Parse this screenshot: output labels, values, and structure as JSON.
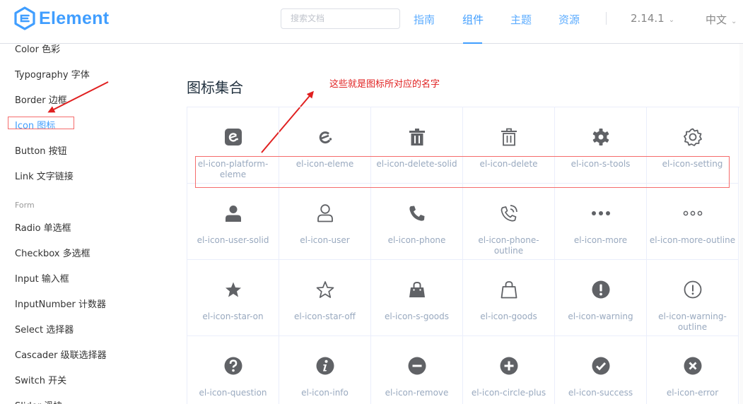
{
  "header": {
    "logo_text": "Element",
    "search_placeholder": "搜索文档",
    "nav": [
      {
        "label": "指南"
      },
      {
        "label": "组件"
      },
      {
        "label": "主题"
      },
      {
        "label": "资源"
      }
    ],
    "version": "2.14.1",
    "language": "中文"
  },
  "sidebar": {
    "items_top": [
      {
        "label": "Color 色彩"
      },
      {
        "label": "Typography 字体"
      },
      {
        "label": "Border 边框"
      },
      {
        "label": "Icon 图标"
      },
      {
        "label": "Button 按钮"
      },
      {
        "label": "Link 文字链接"
      }
    ],
    "group_form": "Form",
    "items_form": [
      {
        "label": "Radio 单选框"
      },
      {
        "label": "Checkbox 多选框"
      },
      {
        "label": "Input 输入框"
      },
      {
        "label": "InputNumber 计数器"
      },
      {
        "label": "Select 选择器"
      },
      {
        "label": "Cascader 级联选择器"
      },
      {
        "label": "Switch 开关"
      },
      {
        "label": "Slider 滑块"
      }
    ]
  },
  "main": {
    "title": "图标集合",
    "annotation": "这些就是图标所对应的名字",
    "icons": [
      {
        "icon": "platform-eleme",
        "name": "el-icon-platform-eleme"
      },
      {
        "icon": "eleme",
        "name": "el-icon-eleme"
      },
      {
        "icon": "delete-solid",
        "name": "el-icon-delete-solid"
      },
      {
        "icon": "delete",
        "name": "el-icon-delete"
      },
      {
        "icon": "s-tools",
        "name": "el-icon-s-tools"
      },
      {
        "icon": "setting",
        "name": "el-icon-setting"
      },
      {
        "icon": "user-solid",
        "name": "el-icon-user-solid"
      },
      {
        "icon": "user",
        "name": "el-icon-user"
      },
      {
        "icon": "phone",
        "name": "el-icon-phone"
      },
      {
        "icon": "phone-outline",
        "name": "el-icon-phone-outline"
      },
      {
        "icon": "more",
        "name": "el-icon-more"
      },
      {
        "icon": "more-outline",
        "name": "el-icon-more-outline"
      },
      {
        "icon": "star-on",
        "name": "el-icon-star-on"
      },
      {
        "icon": "star-off",
        "name": "el-icon-star-off"
      },
      {
        "icon": "s-goods",
        "name": "el-icon-s-goods"
      },
      {
        "icon": "goods",
        "name": "el-icon-goods"
      },
      {
        "icon": "warning",
        "name": "el-icon-warning"
      },
      {
        "icon": "warning-outline",
        "name": "el-icon-warning-outline"
      },
      {
        "icon": "question",
        "name": "el-icon-question"
      },
      {
        "icon": "info",
        "name": "el-icon-info"
      },
      {
        "icon": "remove",
        "name": "el-icon-remove"
      },
      {
        "icon": "circle-plus",
        "name": "el-icon-circle-plus"
      },
      {
        "icon": "success",
        "name": "el-icon-success"
      },
      {
        "icon": "error",
        "name": "el-icon-error"
      }
    ]
  },
  "colors": {
    "primary": "#409eff",
    "icon": "#606266",
    "icon_name": "#99a9bf",
    "annotation": "#e02020"
  }
}
